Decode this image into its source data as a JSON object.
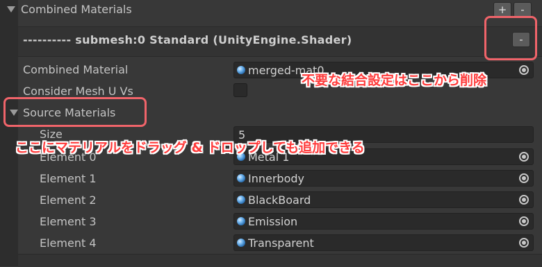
{
  "section": {
    "title": "Combined Materials",
    "add_label": "+",
    "remove_label": "-"
  },
  "submesh": {
    "title": "---------- submesh:0 Standard (UnityEngine.Shader)",
    "remove_label": "-"
  },
  "fields": {
    "combined_material_label": "Combined Material",
    "combined_material_value": "merged-mat0",
    "consider_mesh_uvs_label": "Consider Mesh U Vs",
    "consider_mesh_uvs_checked": false
  },
  "source_materials": {
    "title": "Source Materials",
    "size_label": "Size",
    "size_value": "5",
    "elements": [
      {
        "label": "Element 0",
        "value": "Metal 1"
      },
      {
        "label": "Element 1",
        "value": "Innerbody"
      },
      {
        "label": "Element 2",
        "value": "BlackBoard"
      },
      {
        "label": "Element 3",
        "value": "Emission"
      },
      {
        "label": "Element 4",
        "value": "Transparent"
      }
    ]
  },
  "annotations": {
    "delete_note": "不要な結合設定はここから削除",
    "drag_note": "ここにマテリアルをドラッグ & ドロップしても追加できる",
    "color": "#f0646a"
  }
}
